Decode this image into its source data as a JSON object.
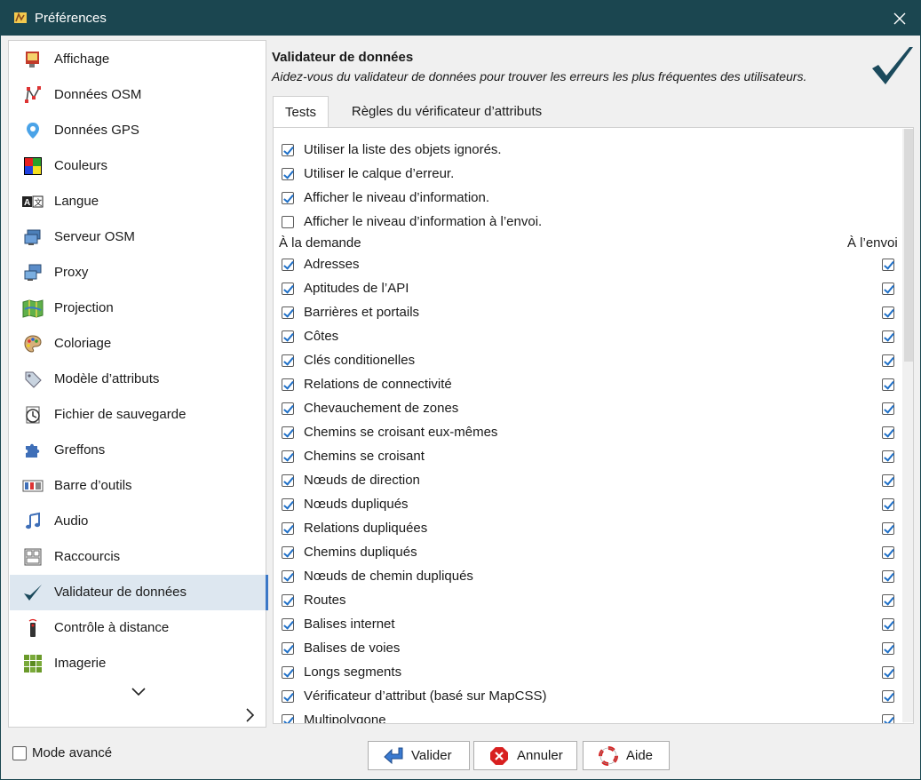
{
  "window": {
    "title": "Préférences"
  },
  "sidebar": {
    "items": [
      {
        "label": "Affichage",
        "icon": "display-icon"
      },
      {
        "label": "Données OSM",
        "icon": "osm-data-icon"
      },
      {
        "label": "Données GPS",
        "icon": "gps-pin-icon"
      },
      {
        "label": "Couleurs",
        "icon": "colors-icon"
      },
      {
        "label": "Langue",
        "icon": "language-icon"
      },
      {
        "label": "Serveur OSM",
        "icon": "server-icon"
      },
      {
        "label": "Proxy",
        "icon": "proxy-icon"
      },
      {
        "label": "Projection",
        "icon": "map-projection-icon"
      },
      {
        "label": "Coloriage",
        "icon": "palette-icon"
      },
      {
        "label": "Modèle d’attributs",
        "icon": "tag-icon"
      },
      {
        "label": "Fichier de sauvegarde",
        "icon": "clock-file-icon"
      },
      {
        "label": "Greffons",
        "icon": "puzzle-icon"
      },
      {
        "label": "Barre d’outils",
        "icon": "toolbar-icon"
      },
      {
        "label": "Audio",
        "icon": "music-note-icon"
      },
      {
        "label": "Raccourcis",
        "icon": "keyboard-icon"
      },
      {
        "label": "Validateur de données",
        "icon": "checkmark-icon",
        "selected": true
      },
      {
        "label": "Contrôle à distance",
        "icon": "remote-icon"
      },
      {
        "label": "Imagerie",
        "icon": "imagery-grid-icon"
      }
    ]
  },
  "main": {
    "heading": "Validateur de données",
    "subheading": "Aidez-vous du validateur de données pour trouver les erreurs les plus fréquentes des utilisateurs.",
    "tabs": [
      {
        "label": "Tests",
        "active": true
      },
      {
        "label": "Règles du vérificateur d’attributs",
        "active": false
      }
    ],
    "options": [
      {
        "label": "Utiliser la liste des objets ignorés.",
        "checked": true
      },
      {
        "label": "Utiliser le calque d’erreur.",
        "checked": true
      },
      {
        "label": "Afficher le niveau d’information.",
        "checked": true
      },
      {
        "label": "Afficher le niveau d’information à l’envoi.",
        "checked": false
      }
    ],
    "col_on_demand": "À la demande",
    "col_on_upload": "À l’envoi",
    "tests": [
      {
        "label": "Adresses",
        "on_demand": true,
        "on_upload": true
      },
      {
        "label": "Aptitudes de l’API",
        "on_demand": true,
        "on_upload": true
      },
      {
        "label": "Barrières et portails",
        "on_demand": true,
        "on_upload": true
      },
      {
        "label": "Côtes",
        "on_demand": true,
        "on_upload": true
      },
      {
        "label": "Clés conditionelles",
        "on_demand": true,
        "on_upload": true
      },
      {
        "label": "Relations de connectivité",
        "on_demand": true,
        "on_upload": true
      },
      {
        "label": "Chevauchement de zones",
        "on_demand": true,
        "on_upload": true
      },
      {
        "label": "Chemins se croisant eux-mêmes",
        "on_demand": true,
        "on_upload": true
      },
      {
        "label": "Chemins se croisant",
        "on_demand": true,
        "on_upload": true
      },
      {
        "label": "Nœuds de direction",
        "on_demand": true,
        "on_upload": true
      },
      {
        "label": "Nœuds dupliqués",
        "on_demand": true,
        "on_upload": true
      },
      {
        "label": "Relations dupliquées",
        "on_demand": true,
        "on_upload": true
      },
      {
        "label": "Chemins dupliqués",
        "on_demand": true,
        "on_upload": true
      },
      {
        "label": "Nœuds de chemin dupliqués",
        "on_demand": true,
        "on_upload": true
      },
      {
        "label": "Routes",
        "on_demand": true,
        "on_upload": true
      },
      {
        "label": "Balises internet",
        "on_demand": true,
        "on_upload": true
      },
      {
        "label": "Balises de voies",
        "on_demand": true,
        "on_upload": true
      },
      {
        "label": "Longs segments",
        "on_demand": true,
        "on_upload": true
      },
      {
        "label": "Vérificateur d’attribut (basé sur MapCSS)",
        "on_demand": true,
        "on_upload": true
      },
      {
        "label": "Multipolygone",
        "on_demand": true,
        "on_upload": true
      }
    ]
  },
  "footer": {
    "advanced_mode": "Mode avancé",
    "ok": "Valider",
    "cancel": "Annuler",
    "help": "Aide"
  }
}
